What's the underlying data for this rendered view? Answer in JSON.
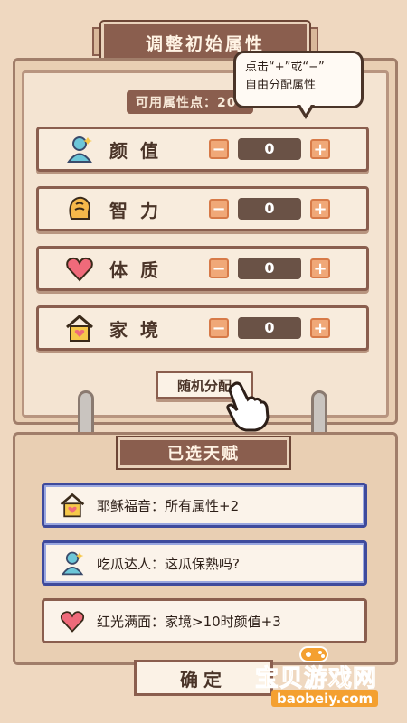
{
  "header": {
    "title": "调整初始属性"
  },
  "points": {
    "label": "可用属性点：20"
  },
  "tooltip": {
    "line1": "点击“+”或“−”",
    "line2": "自由分配属性"
  },
  "attributes": [
    {
      "label": "颜值",
      "value": "0",
      "icon": "person-icon"
    },
    {
      "label": "智力",
      "value": "0",
      "icon": "brain-icon"
    },
    {
      "label": "体质",
      "value": "0",
      "icon": "heart-icon"
    },
    {
      "label": "家境",
      "value": "0",
      "icon": "house-icon"
    }
  ],
  "controls": {
    "minus": "−",
    "plus": "+",
    "random": "随机分配"
  },
  "talents": {
    "title": "已选天赋",
    "items": [
      {
        "text": "耶稣福音：所有属性+2",
        "icon": "house-icon",
        "selected": true
      },
      {
        "text": "吃瓜达人：这瓜保熟吗?",
        "icon": "person-icon",
        "selected": true
      },
      {
        "text": "红光满面：家境>10时颜值+3",
        "icon": "heart-icon",
        "selected": false
      }
    ]
  },
  "confirm": {
    "label": "确定"
  },
  "watermark": {
    "text": "宝贝游戏网",
    "url": "baobeiy.com"
  },
  "colors": {
    "accent": "#8a5e4e",
    "step_button": "#f0a878",
    "selected_border": "#3e4a9c",
    "background": "#efd8c0"
  }
}
